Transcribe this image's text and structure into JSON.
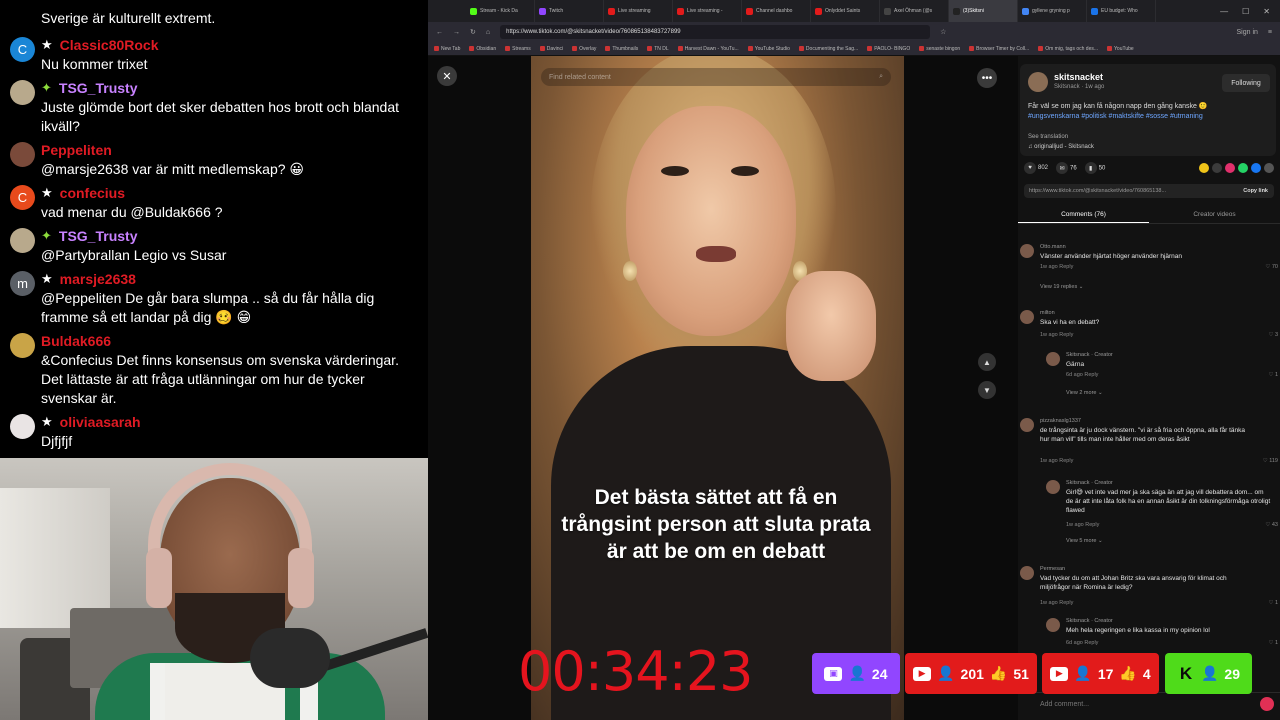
{
  "chat": {
    "top_text": "Sverige är kulturellt extremt.",
    "messages": [
      {
        "user": "Classic80Rock",
        "color": "#e01b24",
        "badge": "star",
        "avatar_letter": "C",
        "avatar_color": "#1a86d6",
        "text": "Nu kommer trixet"
      },
      {
        "user": "TSG_Trusty",
        "color": "#c882ff",
        "badge": "diamond",
        "avatar_letter": "",
        "avatar_color": "#b8a98c",
        "text": "Juste glömde bort det sker debatten hos brott och blandat ikväll?"
      },
      {
        "user": "Peppeliten",
        "color": "#e01b24",
        "badge": "",
        "avatar_letter": "",
        "avatar_color": "#7a4a3a",
        "text": "@marsje2638 var är mitt medlemskap? 😀"
      },
      {
        "user": "confecius",
        "color": "#e01b24",
        "badge": "star",
        "avatar_letter": "C",
        "avatar_color": "#e84a1c",
        "text": "vad menar du @Buldak666 ?"
      },
      {
        "user": "TSG_Trusty",
        "color": "#c882ff",
        "badge": "diamond",
        "avatar_letter": "",
        "avatar_color": "#b8a98c",
        "text": "@Partybrallan Legio vs Susar"
      },
      {
        "user": "marsje2638",
        "color": "#e01b24",
        "badge": "star",
        "avatar_letter": "m",
        "avatar_color": "#5a5f66",
        "text": "@Peppeliten De går bara slumpa .. så du får hålla dig framme så ett landar på dig 🥴 😁"
      },
      {
        "user": "Buldak666",
        "color": "#e01b24",
        "badge": "",
        "avatar_letter": "",
        "avatar_color": "#c9a447",
        "text": "&Confecius Det finns konsensus om svenska värderingar. Det lättaste är att fråga utlänningar om hur de tycker svenskar är."
      },
      {
        "user": "oliviaasarah",
        "color": "#e01b24",
        "badge": "star",
        "avatar_letter": "",
        "avatar_color": "#e9e4e4",
        "text": "Djfjfjf"
      }
    ]
  },
  "browser": {
    "tabs": [
      {
        "label": "Stream - Kick Da",
        "color": "#53fc18"
      },
      {
        "label": "Twitch",
        "color": "#9146ff"
      },
      {
        "label": "Live streaming",
        "color": "#e21b1b"
      },
      {
        "label": "Live streaming -",
        "color": "#e21b1b"
      },
      {
        "label": "Channel dashbo",
        "color": "#e21b1b"
      },
      {
        "label": "Onlyddet Saints",
        "color": "#e21b1b"
      },
      {
        "label": "Axel Öhman (@s",
        "color": "#444444"
      },
      {
        "label": "(3)Skitsni",
        "color": "#222222"
      },
      {
        "label": "gyllene gryning p",
        "color": "#4285f4"
      },
      {
        "label": "EU budget: Who",
        "color": "#1a73e8"
      }
    ],
    "url": "https://www.tiktok.com/@skitsnacket/video/760865138483727899",
    "bookmarks": [
      "New Tab",
      "Obsidian",
      "Streams",
      "Davinci",
      "Overlay",
      "Thumbnails",
      "TN DL",
      "Harvest Dawn - YouTu...",
      "YouTube Studio",
      "Documenting the Sag...",
      "PAOLO- BINGO",
      "senaste bingon",
      "Browser Timer by Coll...",
      "Om mig, tags och des...",
      "YouTube"
    ],
    "sign_in": "Sign in"
  },
  "video": {
    "search_placeholder": "Find related content",
    "caption": "Det bästa sättet att få en trångsint person att sluta prata är att be om en debatt"
  },
  "post": {
    "author": "skitsnacket",
    "sub": "Skitsnack · 1w ago",
    "follow_label": "Following",
    "description": "Får väl se om jag kan få någon napp den gång kanske 🙂",
    "tags": "#ungsvenskarna #politisk #maktskifte #sosse #utmaning",
    "see_translation": "See translation",
    "sound": "originalljud - Skitsnack",
    "likes": "802",
    "comments_count": "76",
    "saves": "50",
    "link": "https://www.tiktok.com/@skitsnacket/video/760865138...",
    "copy_label": "Copy link",
    "tab_comments": "Comments (76)",
    "tab_creator": "Creator videos",
    "add_comment": "Add comment..."
  },
  "comments": [
    {
      "name": "Otto.mann",
      "text": "Vänster använder hjärtat höger använder hjärnan",
      "meta": "1w ago   Reply",
      "likes": "70",
      "view": "View 19 replies ⌄"
    },
    {
      "name": "milton",
      "text": "Ska vi ha en debatt?",
      "meta": "1w ago   Reply",
      "likes": "3"
    },
    {
      "name": "Skitsnack · Creator",
      "text": "Gärna",
      "meta": "6d ago   Reply",
      "likes": "1",
      "view": "View 2 more ⌄"
    },
    {
      "name": "pizzaknaslg1337",
      "text": "de trångsinta är ju dock vänstern. \"vi är så fria och öppna, alla får tänka hur man vill\" tills man inte håller med om deras åsikt",
      "meta": "1w ago   Reply",
      "likes": "119"
    },
    {
      "name": "Skitsnack · Creator",
      "text": "Girl😅 vet inte vad mer ja ska säga än att jag vill debattera dom... om de är att inte låta folk ha en annan åsikt är din tolkningsförmåga otroligt flawed",
      "meta": "1w ago   Reply",
      "likes": "43",
      "view": "View 5 more ⌄"
    },
    {
      "name": "Permesan",
      "text": "Vad tycker du om att Johan Britz ska vara ansvarig för klimat och miljöfrågor när Romina är ledig?",
      "meta": "1w ago   Reply",
      "likes": "1"
    },
    {
      "name": "Skitsnack · Creator",
      "text": "Meh hela regeringen e lika kassa in my opinion lol",
      "meta": "6d ago   Reply",
      "likes": "1"
    }
  ],
  "overlay": {
    "timer": "00:34:23",
    "twitch_viewers": "24",
    "yt1_viewers": "201",
    "yt1_likes": "51",
    "yt2_viewers": "17",
    "yt2_likes": "4",
    "kick_viewers": "29"
  }
}
